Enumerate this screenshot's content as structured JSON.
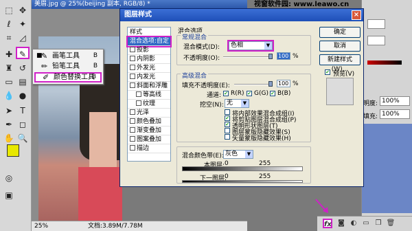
{
  "document": {
    "title": "美眉.jpg @ 25%(beijing 副本, RGB/8) *",
    "watermark": "视窗软件园: www.leawo.cn",
    "zoom": "25%",
    "doc_size": "文档:3.89M/7.78M"
  },
  "tool_flyout": {
    "items": [
      {
        "label": "画笔工具",
        "key": "B",
        "icon": "brush-icon"
      },
      {
        "label": "铅笔工具",
        "key": "B",
        "icon": "pencil-icon"
      },
      {
        "label": "颜色替换工具",
        "key": "B",
        "icon": "color-replace-icon"
      }
    ]
  },
  "dialog": {
    "title": "图层样式",
    "close": "×",
    "styles_header": "样式",
    "styles": [
      {
        "label": "混合选项:自定",
        "selected": true,
        "checkbox": false
      },
      {
        "label": "投影",
        "checkbox": true
      },
      {
        "label": "内阴影",
        "checkbox": true
      },
      {
        "label": "外发光",
        "checkbox": true
      },
      {
        "label": "内发光",
        "checkbox": true
      },
      {
        "label": "斜面和浮雕",
        "checkbox": true
      },
      {
        "label": "等高线",
        "checkbox": true,
        "indent": true
      },
      {
        "label": "纹理",
        "checkbox": true,
        "indent": true
      },
      {
        "label": "光泽",
        "checkbox": true
      },
      {
        "label": "颜色叠加",
        "checkbox": true
      },
      {
        "label": "渐变叠加",
        "checkbox": true
      },
      {
        "label": "图案叠加",
        "checkbox": true
      },
      {
        "label": "描边",
        "checkbox": true
      }
    ],
    "blend": {
      "section": "混合选项",
      "general_title": "常规混合",
      "blend_mode_label": "混合模式(D):",
      "blend_mode_value": "色相",
      "opacity_label": "不透明度(O):",
      "opacity_value": "100",
      "percent": "%",
      "advanced_title": "高级混合",
      "fill_opacity_label": "填充不透明度(E):",
      "fill_opacity_value": "100",
      "channels_label": "通道:",
      "channel_r": "R(R)",
      "channel_g": "G(G)",
      "channel_b": "B(B)",
      "knockout_label": "挖空(N):",
      "knockout_value": "无",
      "options": [
        {
          "label": "将内部效果混合成组(I)",
          "checked": false
        },
        {
          "label": "将剪贴图层混合成组(P)",
          "checked": true
        },
        {
          "label": "透明形状图层(T)",
          "checked": true
        },
        {
          "label": "图层蒙版隐藏效果(S)",
          "checked": false
        },
        {
          "label": "矢量蒙版隐藏效果(H)",
          "checked": false
        }
      ],
      "blend_if_label": "混合颜色带(E):",
      "blend_if_value": "灰色",
      "this_layer_label": "本图层:",
      "underlying_label": "下一图层:",
      "range_min": "0",
      "range_max": "255"
    },
    "buttons": {
      "ok": "确定",
      "cancel": "取消",
      "new_style": "新建样式(W)...",
      "preview_label": "预览(V)"
    }
  },
  "right_panel": {
    "opacity_label": "明度:",
    "opacity_value": "100%",
    "fill_label": "填充:",
    "fill_value": "100%"
  },
  "colors": {
    "foreground": "#e8e800",
    "background": "#ffffff",
    "highlight": "#d020c8"
  }
}
